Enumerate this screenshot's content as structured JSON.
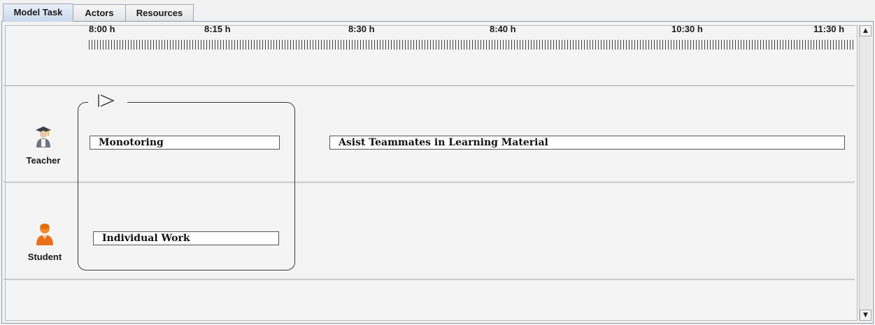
{
  "tabs": [
    {
      "label": "Model Task",
      "active": true
    },
    {
      "label": "Actors",
      "active": false
    },
    {
      "label": "Resources",
      "active": false
    }
  ],
  "timeline": {
    "labels": [
      "8:00 h",
      "8:15 h",
      "8:30 h",
      "8:40 h",
      "10:30 h",
      "11:30 h"
    ]
  },
  "actors": [
    {
      "name": "Teacher",
      "icon": "teacher-icon"
    },
    {
      "name": "Student",
      "icon": "student-icon"
    }
  ],
  "tasks": {
    "monitoring": "Monotoring",
    "assist": "Asist Teammates in Learning Material",
    "individual": "Individual Work"
  },
  "colors": {
    "accent_tab": "#c9d8ea",
    "student_icon": "#e8701a",
    "teacher_cap": "#3a3f46"
  }
}
